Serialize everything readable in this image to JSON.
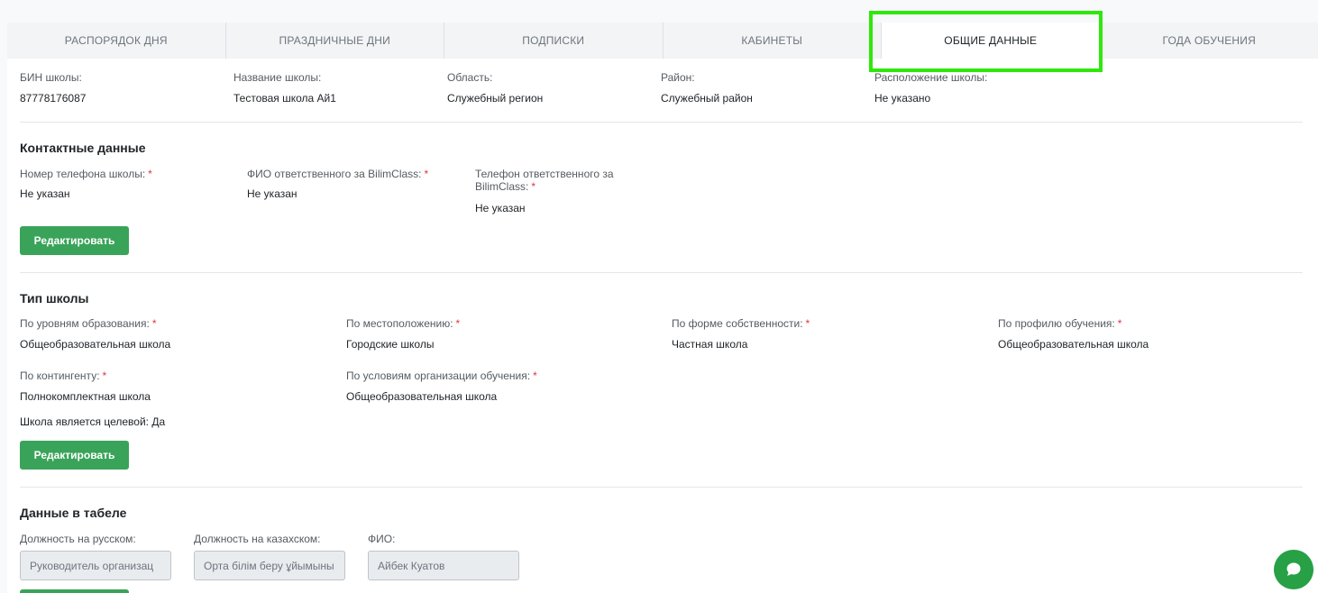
{
  "tabs": [
    {
      "label": "РАСПОРЯДОК ДНЯ"
    },
    {
      "label": "ПРАЗДНИЧНЫЕ ДНИ"
    },
    {
      "label": "ПОДПИСКИ"
    },
    {
      "label": "КАБИНЕТЫ"
    },
    {
      "label": "ОБЩИЕ ДАННЫЕ"
    },
    {
      "label": "ГОДА ОБУЧЕНИЯ"
    }
  ],
  "general": {
    "bin_label": "БИН школы:",
    "bin_value": "87778176087",
    "name_label": "Название школы:",
    "name_value": "Тестовая школа Ай1",
    "region_label": "Область:",
    "region_value": "Служебный регион",
    "district_label": "Район:",
    "district_value": "Служебный район",
    "location_label": "Расположение школы:",
    "location_value": "Не указано"
  },
  "contacts": {
    "title": "Контактные данные",
    "phone_label": "Номер телефона школы:",
    "phone_value": "Не указан",
    "responsible_label": "ФИО ответственного за BilimClass:",
    "responsible_value": "Не указан",
    "responsible_phone_label_line1": "Телефон ответственного за",
    "responsible_phone_label_line2": "BilimClass:",
    "responsible_phone_value": "Не указан",
    "required_mark": "*",
    "edit_button": "Редактировать"
  },
  "school_type": {
    "title": "Тип школы",
    "education_level_label": "По уровням образования:",
    "education_level_value": "Общеобразовательная школа",
    "location_label": "По местоположению:",
    "location_value": "Городские школы",
    "ownership_label": "По форме собственности:",
    "ownership_value": "Частная школа",
    "profile_label": "По профилю обучения:",
    "profile_value": "Общеобразовательная школа",
    "contingent_label": "По контингенту:",
    "contingent_value": "Полнокомплектная школа",
    "conditions_label": "По условиям организации обучения:",
    "conditions_value": "Общеобразовательная школа",
    "target_text": "Школа является целевой: Да",
    "required_mark": "*",
    "edit_button": "Редактировать"
  },
  "timesheet": {
    "title": "Данные в табеле",
    "position_ru_label": "Должность на русском:",
    "position_ru_value": "Руководитель организац",
    "position_kz_label": "Должность на казахском:",
    "position_kz_value": "Орта білім беру ұйымыны",
    "fio_label": "ФИО:",
    "fio_value": "Айбек Куатов"
  },
  "colors": {
    "accent_green": "#3aa35a",
    "highlight": "#2ee80a",
    "required": "#dc3545"
  },
  "icons": {
    "chat": "chat-bubble-icon"
  }
}
